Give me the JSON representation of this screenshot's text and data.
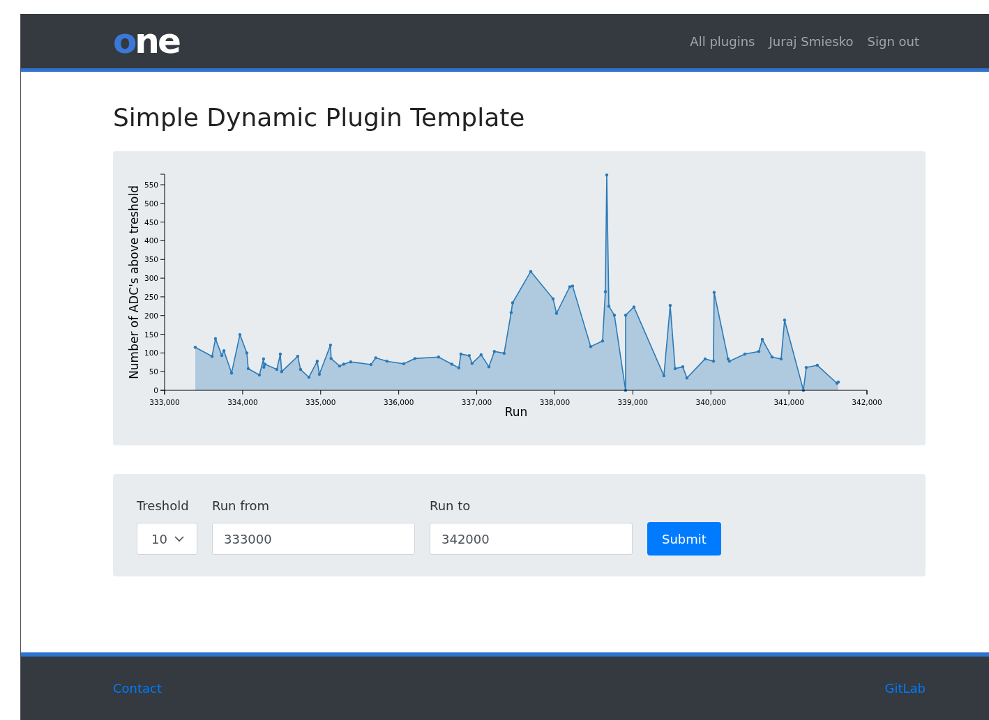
{
  "navbar": {
    "logo": "one",
    "links": [
      "All plugins",
      "Juraj Smiesko",
      "Sign out"
    ]
  },
  "title": "Simple Dynamic Plugin Template",
  "chart": {
    "chart_data": {
      "type": "area",
      "xlabel": "Run",
      "ylabel": "Number of ADC's above treshold",
      "xlim": [
        333000,
        342000
      ],
      "ylim": [
        0,
        578
      ],
      "xticks": [
        {
          "value": 333000,
          "label": "333,000"
        },
        {
          "value": 334000,
          "label": "334,000"
        },
        {
          "value": 335000,
          "label": "335,000"
        },
        {
          "value": 336000,
          "label": "336,000"
        },
        {
          "value": 337000,
          "label": "337,000"
        },
        {
          "value": 338000,
          "label": "338,000"
        },
        {
          "value": 339000,
          "label": "339,000"
        },
        {
          "value": 340000,
          "label": "340,000"
        },
        {
          "value": 341000,
          "label": "341,000"
        },
        {
          "value": 342000,
          "label": "342,000"
        }
      ],
      "yticks": [
        0,
        50,
        100,
        150,
        200,
        250,
        300,
        350,
        400,
        450,
        500,
        550
      ],
      "x": [
        333393,
        333608,
        333652,
        333733,
        333760,
        333858,
        333965,
        334054,
        334072,
        334215,
        334268,
        334272,
        334286,
        334438,
        334483,
        334500,
        334706,
        334742,
        334849,
        334956,
        334983,
        335126,
        335134,
        335242,
        335295,
        335385,
        335644,
        335706,
        335849,
        336064,
        336207,
        336511,
        336681,
        336770,
        336797,
        336904,
        336940,
        337056,
        337155,
        337226,
        337351,
        337441,
        337459,
        337692,
        337978,
        338022,
        338192,
        338228,
        338460,
        338612,
        338648,
        338666,
        338693,
        338764,
        338907,
        338908,
        339014,
        339398,
        339479,
        339542,
        339640,
        339693,
        339926,
        340033,
        340042,
        340221,
        340238,
        340435,
        340614,
        340659,
        340784,
        340900,
        340945,
        341186,
        341222,
        341364,
        341615,
        341633
      ],
      "series": [
        {
          "color": "#2a7ab8",
          "values": [
            115,
            91,
            138,
            93,
            106,
            46,
            149,
            100,
            58,
            41,
            84,
            62,
            70,
            56,
            97,
            50,
            91,
            56,
            35,
            78,
            43,
            121,
            85,
            65,
            70,
            76,
            69,
            87,
            78,
            71,
            85,
            89,
            70,
            60,
            97,
            93,
            72,
            95,
            63,
            104,
            99,
            208,
            234,
            318,
            245,
            206,
            277,
            279,
            117,
            132,
            264,
            576,
            225,
            201,
            0,
            201,
            223,
            39,
            227,
            58,
            63,
            33,
            84,
            78,
            262,
            84,
            78,
            97,
            104,
            136,
            89,
            84,
            188,
            0,
            61,
            67,
            19,
            22
          ]
        }
      ]
    }
  },
  "form": {
    "fields": [
      {
        "kind": "select",
        "label": "Treshold",
        "value": "10"
      },
      {
        "kind": "input",
        "label": "Run from",
        "value": "333000"
      },
      {
        "kind": "input",
        "label": "Run to",
        "value": "342000"
      }
    ],
    "submit": "Submit"
  },
  "footer": {
    "links": [
      "Contact",
      "GitLab"
    ]
  }
}
